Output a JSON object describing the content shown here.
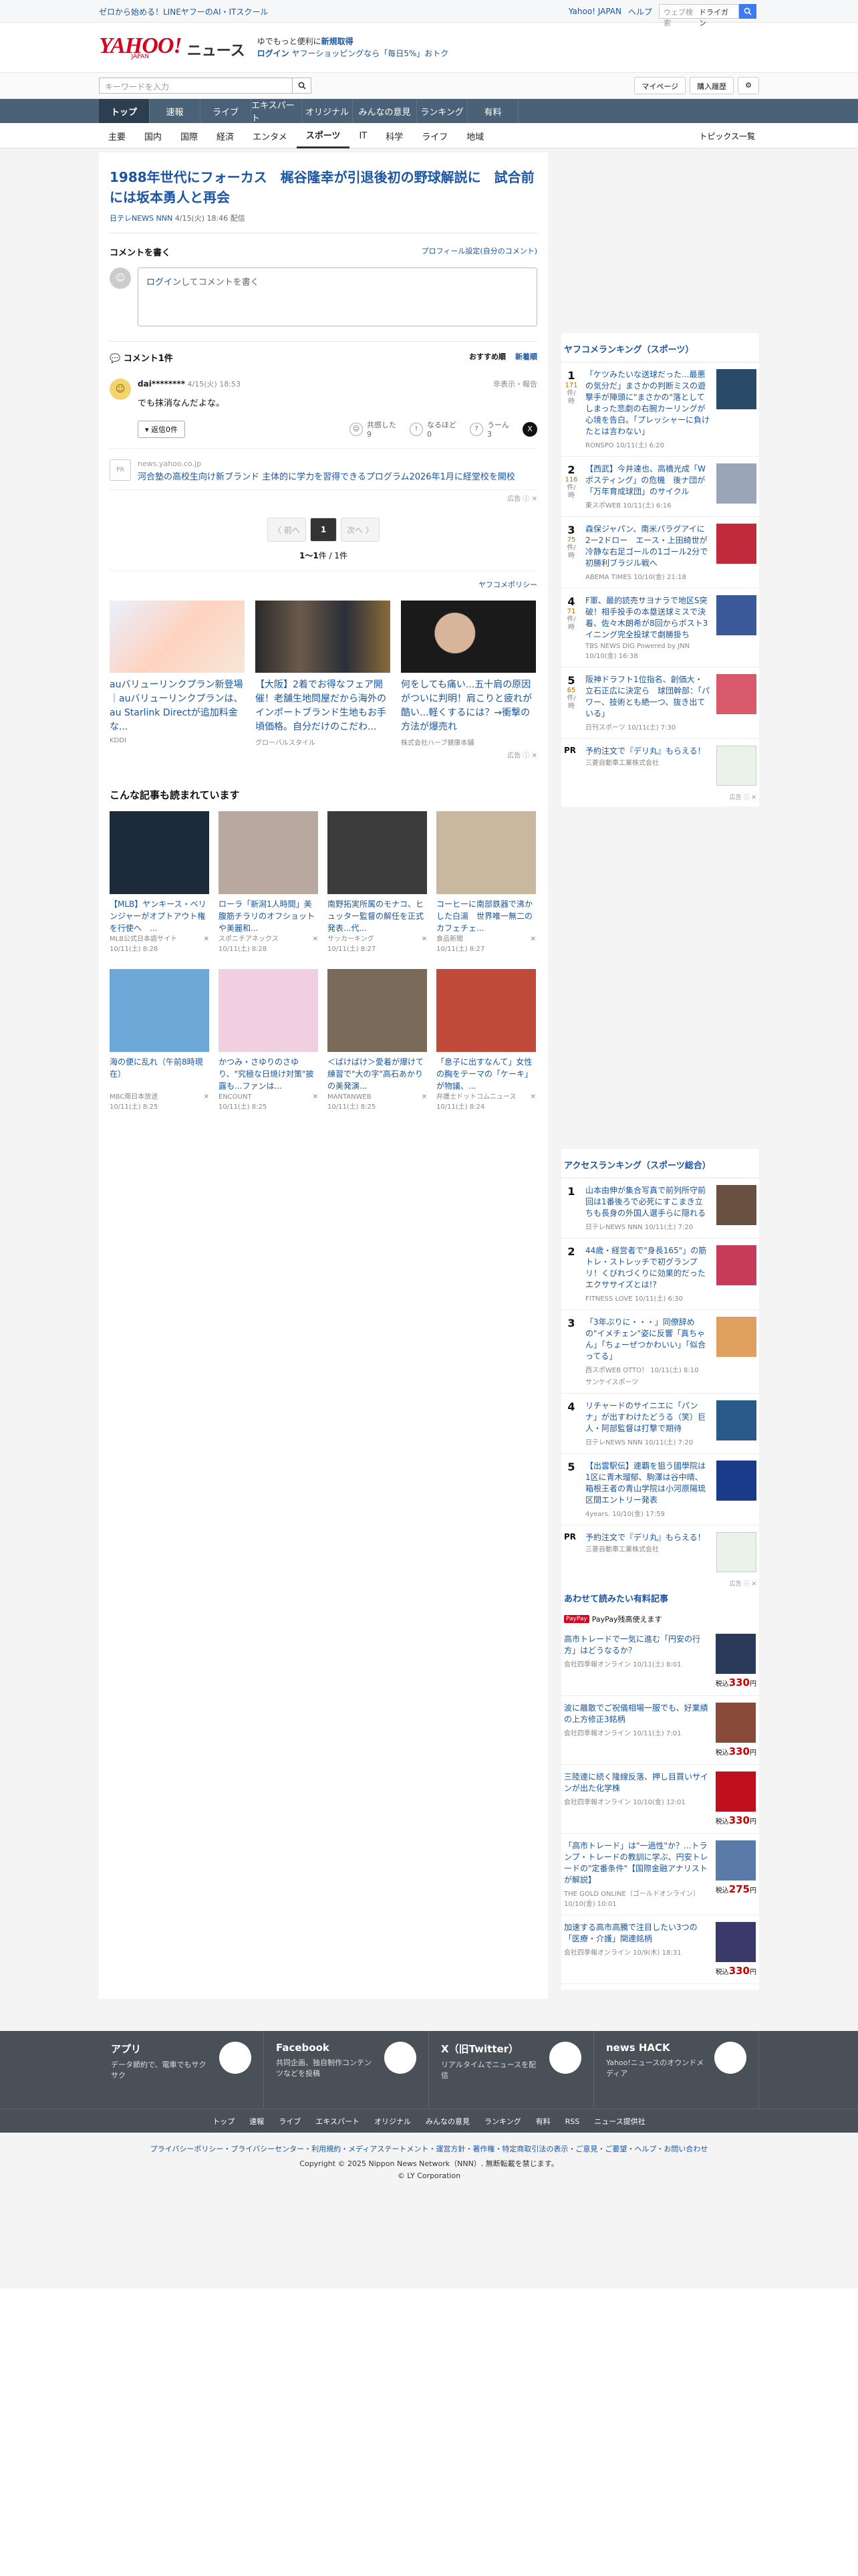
{
  "promo": {
    "text": "ゼロから始める！LINEヤフーのAI・ITスクール",
    "links": [
      "Yahoo! JAPAN",
      "ヘルプ"
    ],
    "search_placeholder": "ウェブ検索",
    "search_tag": "ドライガン"
  },
  "masthead": {
    "logo": "YAHOO!",
    "logo_sub": "JAPAN",
    "section": "ニュース",
    "msg1": "ゆでもっと便利に",
    "msg1_link": "新規取得",
    "msg2_link": "ログイン",
    "msg2": "ヤフーショッピングなら「毎日5%」おトク"
  },
  "search": {
    "placeholder": "キーワードを入力",
    "buttons": [
      "マイページ",
      "購入履歴"
    ]
  },
  "gnav": [
    "トップ",
    "速報",
    "ライブ",
    "エキスパート",
    "オリジナル",
    "みんなの意見",
    "ランキング",
    "有料"
  ],
  "snav": [
    "主要",
    "国内",
    "国際",
    "経済",
    "エンタメ",
    "スポーツ",
    "IT",
    "科学",
    "ライフ",
    "地域"
  ],
  "snav_right": "トピックス一覧",
  "article": {
    "title": "1988年世代にフォーカス　梶谷隆幸が引退後初の野球解説に　試合前には坂本勇人と再会",
    "source": "日テレNEWS NNN",
    "date": "4/15(火) 18:46 配信"
  },
  "comment_box": {
    "title": "コメントを書く",
    "link": "プロフィール設定(自分のコメント)",
    "login": "ログイン",
    "placeholder": "してコメントを書く"
  },
  "comments": {
    "header": "コメント1件",
    "sort": [
      "おすすめ順",
      "新着順"
    ],
    "items": [
      {
        "user": "dai********",
        "date": "4/15(火) 18:53",
        "flag": "非表示・報告",
        "text": "でも抹消なんだよな。",
        "reply": "返信0件",
        "r1": "共感した",
        "r1n": "9",
        "r2": "なるほど",
        "r2n": "0",
        "r3": "うーん",
        "r3n": "3"
      }
    ]
  },
  "inline_ad": {
    "domain": "news.yahoo.co.jp",
    "logo": "PR",
    "text": "河合塾の高校生向け新ブランド 主体的に学力を習得できるプログラム2026年1月に経堂校を開校",
    "tag": "広告"
  },
  "pager": {
    "prev": "〈 前へ",
    "current": "1",
    "next": "次へ 〉",
    "count_a": "1〜1",
    "count_b": "件 / 1件"
  },
  "policy": "ヤフコメポリシー",
  "ads": [
    {
      "title": "auバリューリンクプラン新登場｜auバリューリンクプランは、au Starlink Directが追加料金な...",
      "src": "KDDI"
    },
    {
      "title": "【大阪】2着でお得なフェア開催！老舗生地問屋だから海外のインポートブランド生地もお手頃価格。自分だけのこだわ...",
      "src": "グローバルスタイル"
    },
    {
      "title": "何をしても痛い...五十肩の原因がついに判明！肩こりと疲れが酷い...軽くするには？→衝撃の方法が爆売れ",
      "src": "株式会社ハーブ健康本舗"
    }
  ],
  "read": {
    "title": "こんな記事も読まれています",
    "items": [
      {
        "t": "【MLB】ヤンキース・ベリンジャーがオプトアウト権を行使へ　...",
        "s": "MLB公式日本語サイト",
        "d": "10/11(土) 8:28"
      },
      {
        "t": "ローラ「新潟1人時間」美腹筋チラリのオフショットや美麗和...",
        "s": "スポニチアネックス",
        "d": "10/11(土) 8:28"
      },
      {
        "t": "南野拓実所属のモナコ、ヒュッター監督の解任を正式発表...代...",
        "s": "サッカーキング",
        "d": "10/11(土) 8:27"
      },
      {
        "t": "コーヒーに南部鉄器で沸かした白湯　世界唯一無二のカフェチェ...",
        "s": "食品新聞",
        "d": "10/11(土) 8:27"
      },
      {
        "t": "海の便に乱れ（午前8時現在）",
        "s": "MBC南日本放送",
        "d": "10/11(土) 8:25"
      },
      {
        "t": "かつみ・さゆりのさゆり、\"究極な日焼け対策\"披露も...ファンは...",
        "s": "ENCOUNT",
        "d": "10/11(土) 8:25"
      },
      {
        "t": "＜ばけばけ＞愛着が爆けて練習で\"大の字\"高石あかりの美発演...",
        "s": "MANTANWEB",
        "d": "10/11(土) 8:25"
      },
      {
        "t": "「息子に出すなんて」女性の胸をテーマの「ケーキ」が物議、...",
        "s": "弁護士ドットコムニュース",
        "d": "10/11(土) 8:24"
      }
    ]
  },
  "rank1": {
    "title": "ヤフコメランキング（スポーツ）",
    "unit": "件/時",
    "items": [
      {
        "n": "1",
        "c": "171",
        "t": "「ケツみたいな送球だった...最悪の気分だ」まさかの判断ミスの遊撃手が陣頭に\"まさかの\"落としてしまった悲劇の右腕カーリングが心境を告白。「プレッシャーに負けたとは言わない」",
        "s": "RONSPO 10/11(土) 6:20"
      },
      {
        "n": "2",
        "c": "116",
        "t": "【西武】今井達也、高橋光成「W ポスティング」の危機　後ナ団が「万年育成球団」のサイクル",
        "s": "東スポWEB 10/11(土) 6:16"
      },
      {
        "n": "3",
        "c": "75",
        "t": "森保ジャパン、南米パラグアイに2ー2ドロー　エース・上田綺世が冷静な右足ゴールの1ゴール2分で初勝利ブラジル戦へ",
        "s": "ABEMA TIMES 10/10(金) 21:18"
      },
      {
        "n": "4",
        "c": "71",
        "t": "F軍、最的読売サヨナラで地区S突破！相手投手の本塁送球ミスで決着、佐々木朗希が8回からポスト3イニング完全投球で劇勝掛ち",
        "s": "TBS NEWS DIG Powered by JNN 10/10(金) 16:38"
      },
      {
        "n": "5",
        "c": "65",
        "t": "阪神ドラフト1位指名、創価大・立石正広に決定ら　球団幹部：「パワー、技術とも絶一つ、抜き出ている」",
        "s": "日刊スポーツ 10/11(土) 7:30"
      }
    ],
    "pr": {
      "lab": "PR",
      "t": "予約注文で『デリ丸』もらえる！",
      "s": "三菱自動車工業株式会社"
    }
  },
  "rank2": {
    "title": "アクセスランキング（スポーツ総合）",
    "items": [
      {
        "n": "1",
        "t": "山本由伸が集合写真で前列所守前回は1番後ろで必死にすこまき立ちも長身の外国人選手らに隠れる",
        "s": "日テレNEWS NNN 10/11(土) 7:20"
      },
      {
        "n": "2",
        "t": "44歳・経営者で\"身長165\"」の筋トレ・ストレッチで初グランプリ！くびれづくりに効果的だったエクササイズとは!?",
        "s": "FITNESS LOVE 10/11(土) 6:30"
      },
      {
        "n": "3",
        "t": "「3年ぶりに・・・」同僚辞めの\"イメチェン\"姿に反響「真ちゃん」「ちょーぜつかわいい」「似合ってる」",
        "s": "西スポWEB OTTO！ 10/11(土) 8:10",
        "s2": "サンケイスポーツ"
      },
      {
        "n": "4",
        "t": "リチャードのサイニエに「パンナ」が出すわけたどうる（笑）巨人・阿部監督は打撃で期待",
        "s": "日テレNEWS NNN 10/11(土) 7:20"
      },
      {
        "n": "5",
        "t": "【出雲駅伝】連覇を狙う國學院は1区に青木瑠郁、駒澤は谷中晴、箱根王者の青山学院は小河原陽琉区間エントリー発表",
        "s": "4years. 10/10(金) 17:59"
      }
    ],
    "pr": {
      "lab": "PR",
      "t": "予約注文で『デリ丸』もらえる！",
      "s": "三菱自動車工業株式会社"
    }
  },
  "paid": {
    "title": "あわせて読みたい有料記事",
    "pp": "PayPay",
    "pp_text": "PayPay残高使えます",
    "items": [
      {
        "t": "高市トレードで一気に進む「円安の行方」はどうなるか？",
        "s": "会社四季報オンライン 10/11(土) 8:01",
        "p": "330"
      },
      {
        "t": "波に離散でご祝儀相場一服でも、好業績の上方修正3銘柄",
        "s": "会社四季報オンライン 10/11(土) 7:01",
        "p": "330"
      },
      {
        "t": "三陸連に続く隆線反落、押し目買いサインが出た化学株",
        "s": "会社四季報オンライン 10/10(金) 12:01",
        "p": "330"
      },
      {
        "t": "「高市トレード」は\"一過性\"か？...トランプ・トレードの教訓に学ぶ、円安トレードの\"定番条件\"【国際金融アナリストが解説】",
        "s": "THE GOLD ONLINE（ゴールドオンライン） 10/10(金) 10:01",
        "p": "275"
      },
      {
        "t": "加速する高市高騰で注目したい3つの「医療・介護」関連銘柄",
        "s": "会社四季報オンライン 10/9(木) 18:31",
        "p": "330"
      }
    ],
    "price_prefix": "税込",
    "price_suffix": "円"
  },
  "footer": {
    "cards": [
      {
        "h": "アプリ",
        "p": "データ節約で、電車でもサクサク",
        "ic": "Y!"
      },
      {
        "h": "Facebook",
        "p": "共同企画、独自制作コンテンツなどを投稿",
        "ic": "f"
      },
      {
        "h": "X（旧Twitter）",
        "p": "リアルタイムでニュースを配信",
        "ic": "X"
      },
      {
        "h": "news HACK",
        "p": "Yahoo!ニュースのオウンドメディア",
        "ic": "H"
      }
    ],
    "nav": [
      "トップ",
      "速報",
      "ライブ",
      "エキスパート",
      "オリジナル",
      "みんなの意見",
      "ランキング",
      "有料",
      "RSS",
      "ニュース提供社"
    ],
    "links": "プライバシーポリシー・プライバシーセンター・利用規約・メディアステートメント・運営方針・著作権・特定商取引法の表示・ご意見・ご要望・ヘルプ・お問い合わせ",
    "copy1": "Copyright © 2025 Nippon News Network（NNN）. 無断転載を禁じます。",
    "copy2": "© LY Corporation"
  }
}
